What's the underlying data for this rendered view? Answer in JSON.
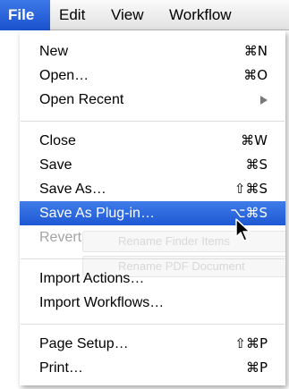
{
  "menubar": {
    "items": [
      "File",
      "Edit",
      "View",
      "Workflow"
    ]
  },
  "menu": {
    "groups": [
      [
        {
          "label": "New",
          "shortcut": "⌘N"
        },
        {
          "label": "Open…",
          "shortcut": "⌘O"
        },
        {
          "label": "Open Recent",
          "submenu": true
        }
      ],
      [
        {
          "label": "Close",
          "shortcut": "⌘W"
        },
        {
          "label": "Save",
          "shortcut": "⌘S"
        },
        {
          "label": "Save As…",
          "shortcut": "⇧⌘S"
        },
        {
          "label": "Save As Plug-in…",
          "shortcut": "⌥⌘S",
          "highlighted": true
        },
        {
          "label": "Revert",
          "disabled": true
        }
      ],
      [
        {
          "label": "Import Actions…"
        },
        {
          "label": "Import Workflows…"
        }
      ],
      [
        {
          "label": "Page Setup…",
          "shortcut": "⇧⌘P"
        },
        {
          "label": "Print…",
          "shortcut": "⌘P"
        }
      ]
    ]
  },
  "background": {
    "ghost_1": "Rename Finder Items",
    "ghost_2": "Rename PDF Document"
  },
  "colors": {
    "highlight": "#2a63dd",
    "disabled_text": "#a3a3a3"
  }
}
